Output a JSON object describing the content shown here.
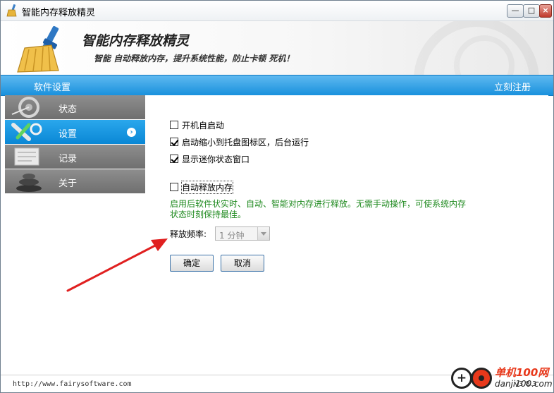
{
  "window": {
    "title": "智能内存释放精灵",
    "minimize_glyph": "—",
    "maximize_glyph": "□",
    "close_glyph": "×"
  },
  "banner": {
    "app_name": "智能内存释放精灵",
    "slogan": "智能 自动释放内存，提升系统性能，防止卡顿 死机！"
  },
  "navbar": {
    "title": "软件设置",
    "register_link": "立刻注册"
  },
  "sidebar": {
    "items": [
      {
        "label": "状态",
        "icon": "gauge-icon",
        "active": false
      },
      {
        "label": "设置",
        "icon": "tools-icon",
        "active": true
      },
      {
        "label": "记录",
        "icon": "log-icon",
        "active": false
      },
      {
        "label": "关于",
        "icon": "about-icon",
        "active": false
      }
    ],
    "active_arrow": "›"
  },
  "settings": {
    "auto_start": {
      "label": "开机自启动",
      "checked": false
    },
    "minimize_to_tray": {
      "label": "启动缩小到托盘图标区，后台运行",
      "checked": true
    },
    "show_mini_window": {
      "label": "显示迷你状态窗口",
      "checked": true
    },
    "auto_release": {
      "label": "自动释放内存",
      "checked": false
    },
    "hint": "启用后软件状实时、自动、智能对内存进行释放。无需手动操作，可使系统内存状态时刻保持最佳。",
    "frequency_label": "释放频率:",
    "frequency_value": "1 分钟",
    "ok_button": "确定",
    "cancel_button": "取消"
  },
  "statusbar": {
    "url": "http://www.fairysoftware.com",
    "version": "v3.8.3"
  },
  "watermark": {
    "cn": "单机100网",
    "en": "danji100.com"
  },
  "colors": {
    "nav_blue": "#1991dd",
    "active_blue": "#0a87d5",
    "sidebar_gray": "#7a7a7a",
    "hint_green": "#1f8a1f",
    "arrow_red": "#e02020"
  }
}
